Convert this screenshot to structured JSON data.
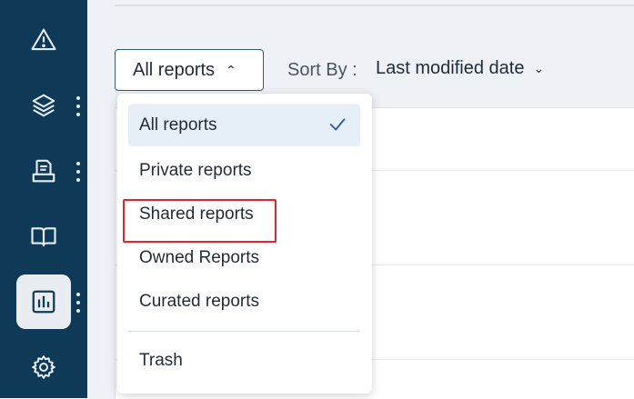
{
  "sidebar": {
    "items": [
      {
        "icon": "alert-triangle-icon"
      },
      {
        "icon": "layers-icon"
      },
      {
        "icon": "document-icon"
      },
      {
        "icon": "book-icon"
      },
      {
        "icon": "report-chart-icon"
      },
      {
        "icon": "gear-icon"
      }
    ]
  },
  "toolbar": {
    "filter_label": "All reports",
    "filter_chevron": "⌃",
    "sort_label": "Sort By :",
    "sort_value": "Last modified date",
    "sort_chevron": "⌄"
  },
  "menu": {
    "items": [
      {
        "label": "All reports",
        "selected": true
      },
      {
        "label": "Private reports"
      },
      {
        "label": "Shared reports",
        "highlighted": true
      },
      {
        "label": "Owned Reports"
      },
      {
        "label": "Curated reports"
      },
      {
        "label": "Trash"
      }
    ]
  },
  "colors": {
    "sidebar": "#0f3a57",
    "accent": "#2f5b7c",
    "highlight": "#e0252b",
    "selected_bg": "#e6eef8"
  }
}
